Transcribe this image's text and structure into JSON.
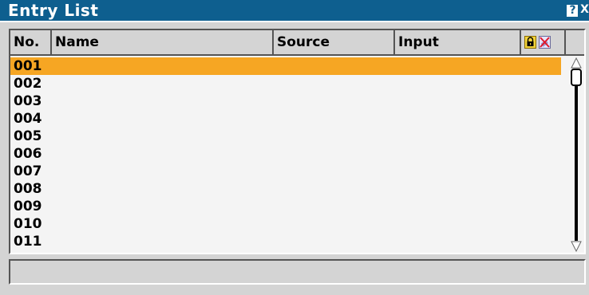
{
  "window": {
    "title": "Entry List",
    "help_glyph": "?",
    "close_glyph": "X"
  },
  "table": {
    "columns": {
      "no": "No.",
      "name": "Name",
      "source": "Source",
      "input": "Input"
    },
    "header_icons": [
      "lock-icon",
      "erase-icon"
    ],
    "rows": [
      {
        "no": "001",
        "selected": true
      },
      {
        "no": "002"
      },
      {
        "no": "003"
      },
      {
        "no": "004"
      },
      {
        "no": "005"
      },
      {
        "no": "006"
      },
      {
        "no": "007"
      },
      {
        "no": "008"
      },
      {
        "no": "009"
      },
      {
        "no": "010"
      },
      {
        "no": "011"
      }
    ]
  },
  "status": {
    "text": ""
  },
  "colors": {
    "titlebar": "#0e5f8f",
    "selection": "#f6a623",
    "background": "#d4d4d4",
    "list_background": "#f4f4f4"
  }
}
